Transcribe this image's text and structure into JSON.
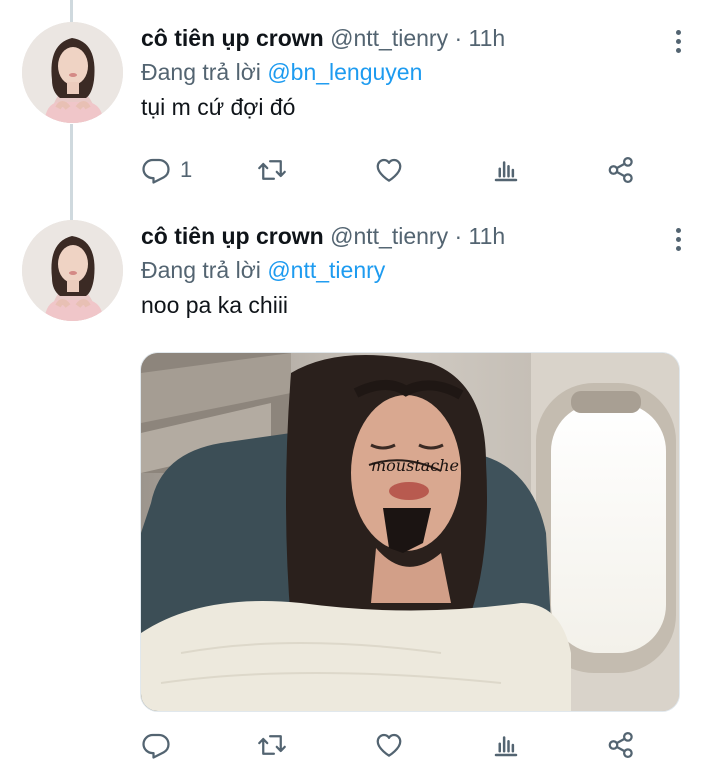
{
  "tweets": [
    {
      "display_name": "cô tiên ụp crown",
      "handle": "@ntt_tienry",
      "separator": "·",
      "time": "11h",
      "replying_prefix": "Đang trả lời",
      "replying_to": "@bn_lenguyen",
      "text": "tụi m cứ đợi đó",
      "reply_count": "1"
    },
    {
      "display_name": "cô tiên ụp crown",
      "handle": "@ntt_tienry",
      "separator": "·",
      "time": "11h",
      "replying_prefix": "Đang trả lời",
      "replying_to": "@ntt_tienry",
      "text": "noo pa ka chiii",
      "reply_count": "",
      "photo_handwriting": "moustache"
    }
  ],
  "icons": {
    "reply": "reply-icon",
    "retweet": "retweet-icon",
    "like": "heart-icon",
    "analytics": "analytics-icon",
    "share": "share-icon",
    "more": "more-vertical-icon"
  },
  "colors": {
    "text": "#0f1419",
    "secondary": "#536471",
    "link": "#1d9bf0",
    "thread_line": "#cfd9de"
  }
}
